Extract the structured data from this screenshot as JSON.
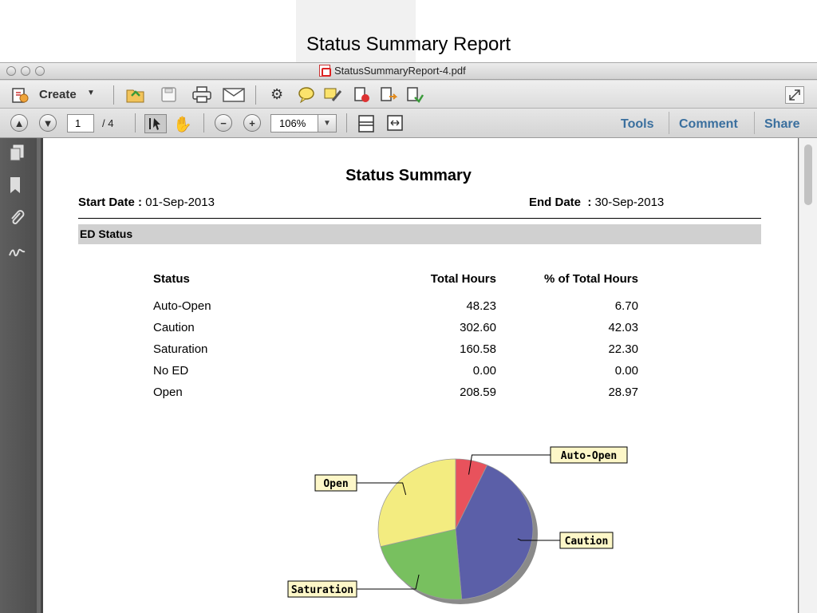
{
  "slide": {
    "title": "Status Summary Report"
  },
  "window": {
    "title": "StatusSummaryReport-4.pdf"
  },
  "toolbar": {
    "create_label": "Create",
    "page_current": "1",
    "page_total": "/ 4",
    "zoom": "106%",
    "tabs": [
      "Tools",
      "Comment",
      "Share"
    ]
  },
  "report": {
    "title": "Status Summary",
    "start_label": "Start Date :",
    "start_date": "01-Sep-2013",
    "end_label": "End Date  :",
    "end_date": "30-Sep-2013",
    "section": "ED Status",
    "columns": [
      "Status",
      "Total Hours",
      "% of Total Hours"
    ],
    "rows": [
      [
        "Auto-Open",
        "48.23",
        "6.70"
      ],
      [
        "Caution",
        "302.60",
        "42.03"
      ],
      [
        "Saturation",
        "160.58",
        "22.30"
      ],
      [
        "No ED",
        "0.00",
        "0.00"
      ],
      [
        "Open",
        "208.59",
        "28.97"
      ]
    ]
  },
  "chart_data": {
    "type": "pie",
    "categories": [
      "Auto-Open",
      "Caution",
      "Saturation",
      "No ED",
      "Open"
    ],
    "values": [
      6.7,
      42.03,
      22.3,
      0.0,
      28.97
    ],
    "labels_shown": [
      "Auto-Open",
      "Caution",
      "Saturation",
      "Open"
    ],
    "colors": [
      "#e8525c",
      "#5b5fa8",
      "#78c05f",
      "#cccccc",
      "#f3ec80"
    ]
  },
  "colors": {
    "accent": "#3a6f9e",
    "section_bar": "#d0d0d0"
  }
}
